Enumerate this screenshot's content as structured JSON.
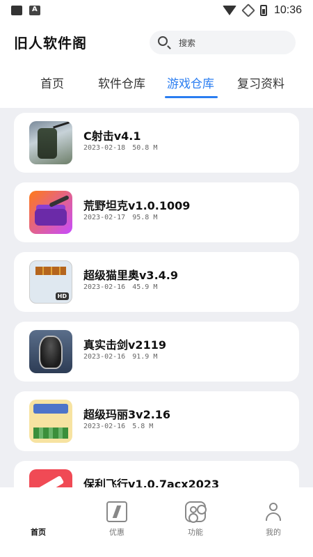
{
  "status_bar": {
    "time": "10:36",
    "left_icons": [
      "image-notification-icon",
      "text-notification-icon"
    ],
    "right_icons": [
      "wifi-icon",
      "no-signal-icon",
      "battery-icon"
    ]
  },
  "header": {
    "title": "旧人软件阁",
    "search_placeholder": "搜索"
  },
  "tabs": [
    {
      "label": "首页",
      "active": false
    },
    {
      "label": "软件仓库",
      "active": false
    },
    {
      "label": "游戏仓库",
      "active": true
    },
    {
      "label": "复习资料",
      "active": false
    }
  ],
  "accent_color": "#2a7df1",
  "games": [
    {
      "name": "C射击v4.1",
      "date": "2023-02-18",
      "size": "50.8  M",
      "icon": "soldier-game-icon"
    },
    {
      "name": "荒野坦克v1.0.1009",
      "date": "2023-02-17",
      "size": "95.8  M",
      "icon": "tank-game-icon"
    },
    {
      "name": "超级猫里奥v3.4.9",
      "date": "2023-02-16",
      "size": "45.9  M",
      "icon": "cat-mario-game-icon"
    },
    {
      "name": "真实击剑v2119",
      "date": "2023-02-16",
      "size": "91.9  M",
      "icon": "fencing-mask-icon"
    },
    {
      "name": "超级玛丽3v2.16",
      "date": "2023-02-16",
      "size": "5.8  M",
      "icon": "super-mario-game-icon"
    },
    {
      "name": "保利飞行v1.0.7acx2023",
      "date": "",
      "size": "",
      "icon": "plane-game-icon"
    }
  ],
  "bottom_nav": [
    {
      "label": "首页",
      "icon": "home-icon",
      "active": true
    },
    {
      "label": "优惠",
      "icon": "bolt-icon",
      "active": false
    },
    {
      "label": "功能",
      "icon": "function-icon",
      "active": false
    },
    {
      "label": "我的",
      "icon": "user-icon",
      "active": false
    }
  ]
}
